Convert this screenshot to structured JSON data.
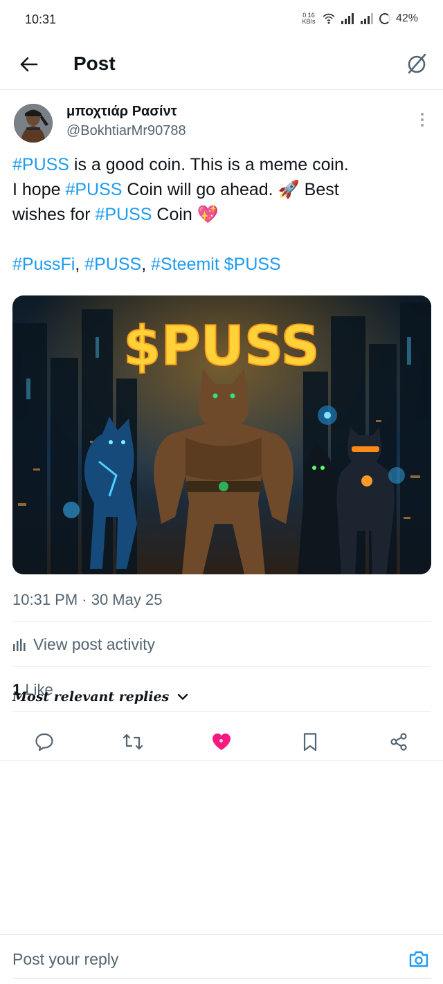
{
  "status_bar": {
    "time": "10:31",
    "net_speed_value": "0.16",
    "net_speed_unit": "KB/s",
    "battery": "42%"
  },
  "header": {
    "title": "Post"
  },
  "tweet": {
    "display_name": "μποχτιάρ Ρασίντ",
    "handle": "@BokhtiarMr90788",
    "text": {
      "tag_puss": "#PUSS",
      "line1_rest": " is a good coin. This is a meme coin.",
      "line2_pre": "I hope ",
      "line2_post": " Coin will go ahead. 🚀 Best",
      "line3_pre": "wishes for ",
      "line3_post": " Coin 💖",
      "hashtags": [
        "#PussFi",
        "#PUSS",
        "#Steemit",
        "$PUSS"
      ],
      "comma": ","
    },
    "media": {
      "headline": "$PUSS"
    },
    "timestamp": "10:31 PM · 30 May 25",
    "view_activity": "View post activity",
    "likes_count": "1",
    "likes_label": " Like",
    "liked": true
  },
  "replies": {
    "sort_label": "Most relevant replies"
  },
  "reply_bar": {
    "placeholder": "Post your reply"
  },
  "colors": {
    "accent": "#1d9bf0",
    "like": "#f91880",
    "text": "#0f1419",
    "muted": "#536471"
  },
  "icons": [
    "back-arrow-icon",
    "grok-icon",
    "more-vertical-icon",
    "reply-icon",
    "repost-icon",
    "heart-icon",
    "bookmark-icon",
    "share-icon",
    "bar-chart-icon",
    "chevron-down-icon",
    "camera-icon"
  ]
}
